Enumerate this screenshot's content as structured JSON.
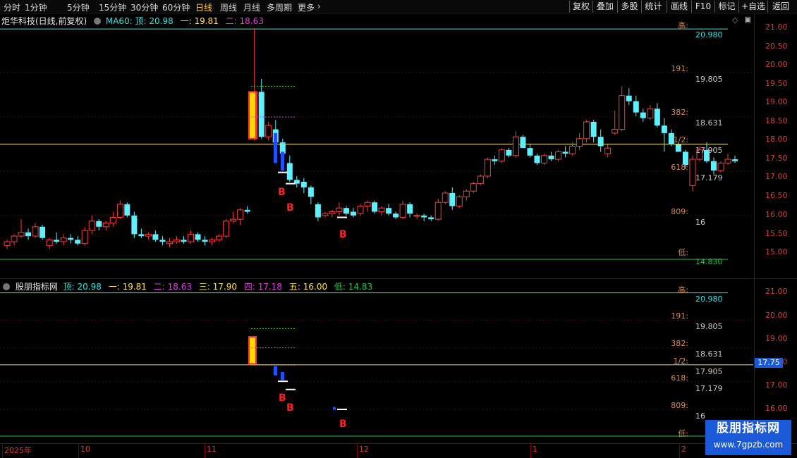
{
  "toolbar": {
    "periods": [
      {
        "label": "分时",
        "x": 5
      },
      {
        "label": "1分钟",
        "x": 35
      },
      {
        "label": "5分钟",
        "x": 95
      },
      {
        "label": "15分钟",
        "x": 140
      },
      {
        "label": "30分钟",
        "x": 185
      },
      {
        "label": "60分钟",
        "x": 230
      },
      {
        "label": "日线",
        "x": 277,
        "active": true
      },
      {
        "label": "周线",
        "x": 312
      },
      {
        "label": "月线",
        "x": 345
      },
      {
        "label": "多周期",
        "x": 378
      },
      {
        "label": "更多",
        "x": 422
      }
    ],
    "more_chevron": "›",
    "buttons": [
      {
        "label": "复权",
        "x": 807,
        "w": 32
      },
      {
        "label": "叠加",
        "x": 840,
        "w": 34
      },
      {
        "label": "多股",
        "x": 875,
        "w": 33
      },
      {
        "label": "统计",
        "x": 909,
        "w": 33
      },
      {
        "label": "画线",
        "x": 945,
        "w": 34
      },
      {
        "label": "F10",
        "x": 980,
        "w": 32
      },
      {
        "label": "标记",
        "x": 1013,
        "w": 33
      },
      {
        "label": "+自选",
        "x": 1047,
        "w": 40
      },
      {
        "label": "返回",
        "x": 1088,
        "w": 36
      }
    ]
  },
  "main_panel": {
    "stock_title": "炬华科技(日线,前复权)",
    "indicator_name": "MA60:",
    "top_label": "顶: 20.98",
    "one_label": "一: 19.81",
    "two_label": "二: 18.63",
    "y_axis": [
      "21.00",
      "20.50",
      "20.00",
      "19.50",
      "19.00",
      "18.50",
      "18.00",
      "17.50",
      "17.00",
      "16.50",
      "16.00",
      "15.50",
      "15.00"
    ],
    "fib_labels": [
      "高:",
      "191:",
      "382:",
      "1/2:",
      "618:",
      "809:",
      "低:"
    ],
    "fib_values": [
      "20.980",
      "19.805",
      "18.631",
      "17.905",
      "17.179",
      "16",
      "14.830"
    ]
  },
  "sub_panel": {
    "indicator_title": "股朋指标网",
    "top_label": "顶: 20.98",
    "one_label": "一: 19.81",
    "two_label": "二: 18.63",
    "three_label": "三: 17.90",
    "four_label": "四: 17.18",
    "five_label": "五: 16.00",
    "low_label": "低: 14.83",
    "y_axis": [
      "21.00",
      "20.00",
      "19.00",
      "18.00",
      "17.00",
      "16.00"
    ],
    "fib_labels": [
      "高:",
      "191:",
      "382:",
      "1/2:",
      "618:",
      "809:",
      "低:"
    ],
    "fib_values": [
      "20.980",
      "19.805",
      "18.631",
      "17.905",
      "17.179",
      "16"
    ],
    "price_tag": "17.75"
  },
  "b_marker": "B",
  "date_axis": [
    "2025年",
    "10",
    "11",
    "12",
    "1",
    "2"
  ],
  "watermark": {
    "line1": "股朋指标网",
    "line2": "www.7gpzb.com"
  },
  "colors": {
    "up": "#ff3c3c",
    "down": "#5ef0ff",
    "level_line": "#ffe34a",
    "high_line": "#38e0e0",
    "low_line": "#26c24a",
    "marker": "#ff2020"
  },
  "chart_data": {
    "type": "candlestick",
    "stock": "炬华科技",
    "period": "日线",
    "ylim": [
      14.6,
      21.3
    ],
    "fib_levels": [
      20.98,
      19.805,
      18.631,
      17.905,
      17.179,
      16.0,
      14.83
    ],
    "ohlc": [
      [
        15.2,
        15.35,
        15.1,
        15.3
      ],
      [
        15.3,
        15.5,
        15.2,
        15.45
      ],
      [
        15.45,
        15.9,
        15.4,
        15.55
      ],
      [
        15.55,
        15.65,
        15.35,
        15.45
      ],
      [
        15.45,
        15.8,
        15.4,
        15.7
      ],
      [
        15.7,
        15.75,
        15.35,
        15.4
      ],
      [
        15.2,
        15.4,
        15.1,
        15.35
      ],
      [
        15.35,
        15.55,
        15.25,
        15.3
      ],
      [
        15.3,
        15.5,
        15.2,
        15.4
      ],
      [
        15.4,
        15.5,
        15.25,
        15.35
      ],
      [
        15.35,
        15.45,
        15.2,
        15.25
      ],
      [
        15.25,
        15.7,
        15.2,
        15.6
      ],
      [
        15.6,
        16.0,
        15.5,
        15.85
      ],
      [
        15.85,
        15.9,
        15.6,
        15.7
      ],
      [
        15.7,
        15.85,
        15.6,
        15.8
      ],
      [
        15.8,
        16.1,
        15.7,
        15.95
      ],
      [
        15.95,
        16.4,
        15.9,
        16.3
      ],
      [
        16.3,
        16.35,
        15.95,
        16.0
      ],
      [
        16.0,
        16.1,
        15.4,
        15.5
      ],
      [
        15.5,
        15.65,
        15.4,
        15.45
      ],
      [
        15.45,
        15.55,
        15.35,
        15.5
      ],
      [
        15.5,
        15.6,
        15.3,
        15.35
      ],
      [
        15.35,
        15.45,
        15.2,
        15.3
      ],
      [
        15.25,
        15.4,
        15.15,
        15.3
      ],
      [
        15.3,
        15.45,
        15.25,
        15.35
      ],
      [
        15.35,
        15.45,
        15.25,
        15.3
      ],
      [
        15.3,
        15.6,
        15.25,
        15.5
      ],
      [
        15.5,
        15.55,
        15.3,
        15.35
      ],
      [
        15.35,
        15.45,
        15.2,
        15.3
      ],
      [
        15.3,
        15.4,
        15.2,
        15.35
      ],
      [
        15.35,
        15.5,
        15.3,
        15.45
      ],
      [
        15.45,
        15.9,
        15.4,
        15.85
      ],
      [
        15.85,
        16.1,
        15.8,
        15.9
      ],
      [
        15.9,
        16.2,
        15.75,
        16.15
      ],
      [
        16.15,
        16.25,
        16.05,
        16.1
      ],
      [
        18.05,
        21.0,
        18.0,
        19.3
      ],
      [
        19.3,
        19.65,
        18.05,
        18.1
      ],
      [
        18.1,
        18.5,
        18.0,
        18.4
      ],
      [
        18.3,
        18.55,
        17.7,
        17.95
      ],
      [
        17.95,
        18.05,
        17.7,
        17.65
      ],
      [
        17.4,
        17.6,
        16.9,
        16.95
      ],
      [
        16.95,
        17.05,
        16.75,
        16.85
      ],
      [
        16.9,
        17.0,
        16.6,
        16.75
      ],
      [
        16.75,
        16.8,
        16.3,
        16.5
      ],
      [
        16.3,
        16.35,
        15.85,
        15.95
      ],
      [
        16.0,
        16.1,
        15.95,
        16.05
      ],
      [
        16.05,
        16.15,
        15.95,
        16.1
      ],
      [
        16.1,
        16.35,
        16.0,
        16.2
      ],
      [
        16.2,
        16.25,
        16.0,
        16.05
      ],
      [
        16.1,
        16.2,
        15.95,
        16.0
      ],
      [
        16.05,
        16.3,
        16.0,
        16.25
      ],
      [
        16.25,
        16.4,
        16.1,
        16.35
      ],
      [
        16.35,
        16.4,
        16.05,
        16.1
      ],
      [
        16.1,
        16.25,
        16.0,
        16.2
      ],
      [
        16.2,
        16.3,
        16.0,
        16.05
      ],
      [
        16.05,
        16.1,
        15.9,
        15.95
      ],
      [
        15.95,
        16.4,
        15.9,
        16.3
      ],
      [
        16.3,
        16.35,
        15.95,
        16.05
      ],
      [
        16.0,
        16.05,
        15.9,
        16.0
      ],
      [
        16.0,
        16.05,
        15.85,
        15.95
      ],
      [
        15.95,
        16.0,
        15.85,
        15.9
      ],
      [
        15.9,
        16.45,
        15.85,
        16.35
      ],
      [
        16.35,
        16.65,
        16.3,
        16.6
      ],
      [
        16.6,
        16.75,
        16.15,
        16.25
      ],
      [
        16.25,
        16.55,
        16.2,
        16.5
      ],
      [
        16.5,
        16.7,
        16.4,
        16.65
      ],
      [
        16.65,
        16.9,
        16.6,
        16.85
      ],
      [
        16.85,
        17.1,
        16.8,
        17.05
      ],
      [
        17.05,
        17.55,
        17.0,
        17.5
      ],
      [
        17.5,
        17.6,
        17.35,
        17.45
      ],
      [
        17.45,
        17.8,
        17.4,
        17.75
      ],
      [
        17.75,
        17.8,
        17.55,
        17.6
      ],
      [
        17.6,
        18.25,
        17.55,
        18.1
      ],
      [
        18.1,
        18.15,
        17.8,
        17.8
      ],
      [
        17.8,
        17.9,
        17.55,
        17.6
      ],
      [
        17.6,
        17.65,
        17.35,
        17.4
      ],
      [
        17.4,
        17.65,
        17.35,
        17.6
      ],
      [
        17.6,
        17.7,
        17.45,
        17.5
      ],
      [
        17.5,
        17.75,
        17.45,
        17.7
      ],
      [
        17.7,
        17.85,
        17.55,
        17.65
      ],
      [
        17.65,
        17.95,
        17.6,
        17.85
      ],
      [
        17.85,
        18.2,
        17.75,
        18.05
      ],
      [
        18.05,
        18.55,
        17.95,
        18.5
      ],
      [
        18.5,
        18.55,
        17.95,
        18.1
      ],
      [
        18.1,
        18.3,
        17.7,
        17.85
      ],
      [
        17.65,
        17.9,
        17.55,
        17.8
      ],
      [
        18.2,
        18.8,
        18.15,
        18.3
      ],
      [
        18.3,
        19.45,
        18.25,
        19.2
      ],
      [
        19.2,
        19.4,
        18.95,
        19.05
      ],
      [
        19.05,
        19.2,
        18.65,
        18.75
      ],
      [
        18.75,
        18.85,
        18.5,
        18.6
      ],
      [
        18.6,
        18.95,
        18.55,
        18.85
      ],
      [
        18.85,
        19.0,
        18.35,
        18.4
      ],
      [
        18.4,
        18.6,
        17.7,
        18.2
      ],
      [
        18.2,
        18.3,
        17.85,
        17.9
      ],
      [
        17.9,
        17.95,
        17.7,
        17.7
      ],
      [
        17.7,
        17.75,
        17.25,
        17.35
      ],
      [
        16.8,
        17.6,
        16.65,
        17.5
      ],
      [
        17.5,
        17.85,
        17.45,
        17.75
      ],
      [
        17.75,
        17.95,
        17.4,
        17.45
      ],
      [
        17.45,
        17.55,
        17.1,
        17.2
      ],
      [
        17.2,
        17.45,
        17.15,
        17.4
      ],
      [
        17.4,
        17.65,
        17.35,
        17.5
      ],
      [
        17.5,
        17.6,
        17.4,
        17.45
      ]
    ]
  }
}
